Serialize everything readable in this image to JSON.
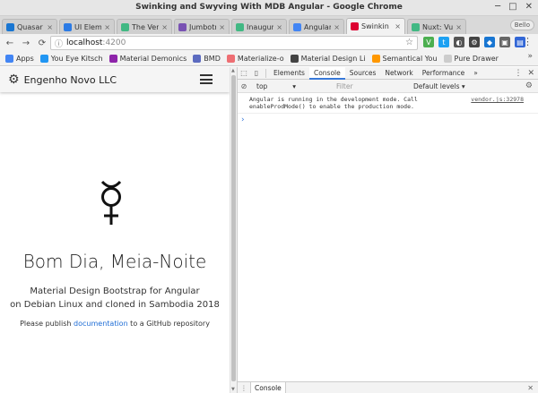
{
  "window": {
    "title": "Swinking and Swyving With MDB Angular - Google Chrome",
    "controls": [
      "─",
      "□",
      "✕"
    ]
  },
  "tabs": [
    {
      "label": "Quasar F",
      "color": "#1976d2"
    },
    {
      "label": "UI Eleme",
      "color": "#2c7be5"
    },
    {
      "label": "The Very",
      "color": "#41b883"
    },
    {
      "label": "Jumbotr",
      "color": "#7952b3"
    },
    {
      "label": "Inaugur",
      "color": "#41b883"
    },
    {
      "label": "Angular",
      "color": "#4285f4"
    },
    {
      "label": "Swinkin",
      "color": "#dd0031"
    },
    {
      "label": "Nuxt: Vu",
      "color": "#41b883"
    }
  ],
  "profile_badge": "Bello",
  "address": {
    "host": "localhost",
    "port": ":4200"
  },
  "bookmarks": [
    {
      "label": "Apps",
      "color": "#4285f4"
    },
    {
      "label": "You Eye Kitsch",
      "color": "#2196f3"
    },
    {
      "label": "Material Demonics",
      "color": "#8e24aa"
    },
    {
      "label": "BMD",
      "color": "#5c6bc0"
    },
    {
      "label": "Materialize-o",
      "color": "#ee6e73"
    },
    {
      "label": "Material Design Li",
      "color": "#444444"
    },
    {
      "label": "Semantical You",
      "color": "#ff9800"
    },
    {
      "label": "Pure Drawer",
      "color": "#cccccc"
    }
  ],
  "bookmarks_more": "»",
  "app": {
    "brand": "Engenho Novo LLC",
    "hero_title": "Bom Dia, Meia-Noite",
    "hero_sub_line1": "Material Design Bootstrap for Angular",
    "hero_sub_line2": "on Debian Linux and cloned in Sambodia 2018",
    "note_before": "Please publish ",
    "note_link": "documentation",
    "note_after": " to a GitHub repository"
  },
  "devtools": {
    "tabs": [
      "Elements",
      "Console",
      "Sources",
      "Network",
      "Performance"
    ],
    "active_tab": "Console",
    "more": "»",
    "context": "top",
    "filter_placeholder": "Filter",
    "levels": "Default levels ▾",
    "log_line1": "Angular is running in the development mode. Call",
    "log_line2": "enableProdMode() to enable the production mode.",
    "log_source": "vendor.js:32978",
    "prompt": "›",
    "drawer_tab": "Console"
  },
  "colors": {
    "accent": "#3879d9",
    "link": "#1e6dd6"
  }
}
